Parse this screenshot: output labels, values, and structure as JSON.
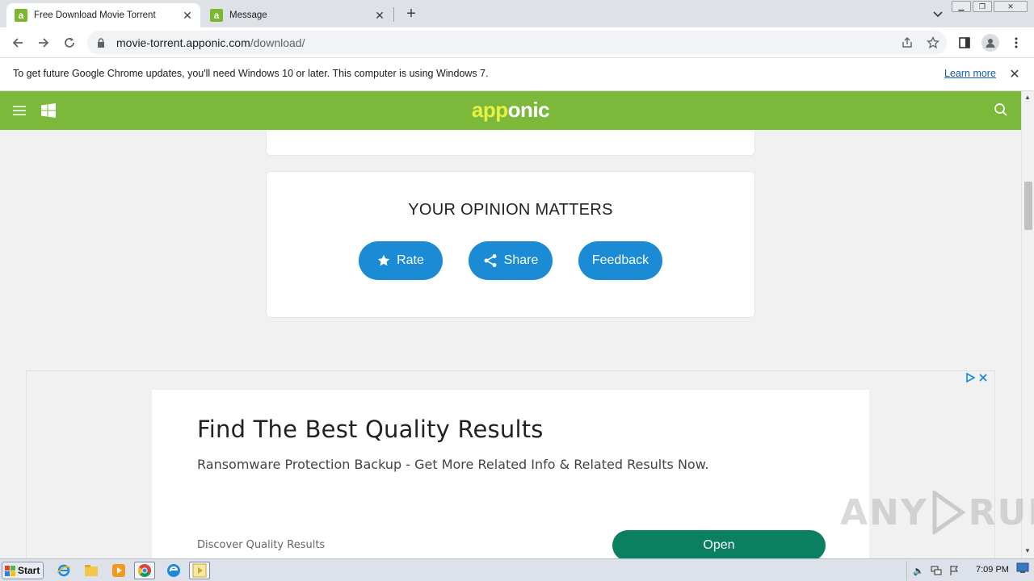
{
  "browser": {
    "tabs": [
      {
        "title": "Free Download Movie Torrent",
        "favicon_letter": "a",
        "active": true
      },
      {
        "title": "Message",
        "favicon_letter": "a",
        "active": false
      }
    ],
    "url_host": "movie-torrent.apponic.com",
    "url_path": "/download/",
    "infobar": {
      "message": "To get future Google Chrome updates, you'll need Windows 10 or later. This computer is using Windows 7.",
      "link": "Learn more"
    }
  },
  "site": {
    "brand_part1": "app",
    "brand_part2": "onic",
    "header_color": "#7cb83a",
    "opinion": {
      "title": "YOUR OPINION MATTERS",
      "buttons": {
        "rate": "Rate",
        "share": "Share",
        "feedback": "Feedback"
      },
      "button_color": "#1a8bd4"
    }
  },
  "ad": {
    "title": "Find The Best Quality Results",
    "subtitle": "Ransomware Protection Backup - Get More Related Info & Related Results Now.",
    "small_text": "Discover Quality Results",
    "cta": "Open",
    "cta_color": "#0b8061"
  },
  "watermark": {
    "text_left": "ANY",
    "text_right": "RUN"
  },
  "taskbar": {
    "start_label": "Start",
    "clock": "7:09 PM"
  }
}
